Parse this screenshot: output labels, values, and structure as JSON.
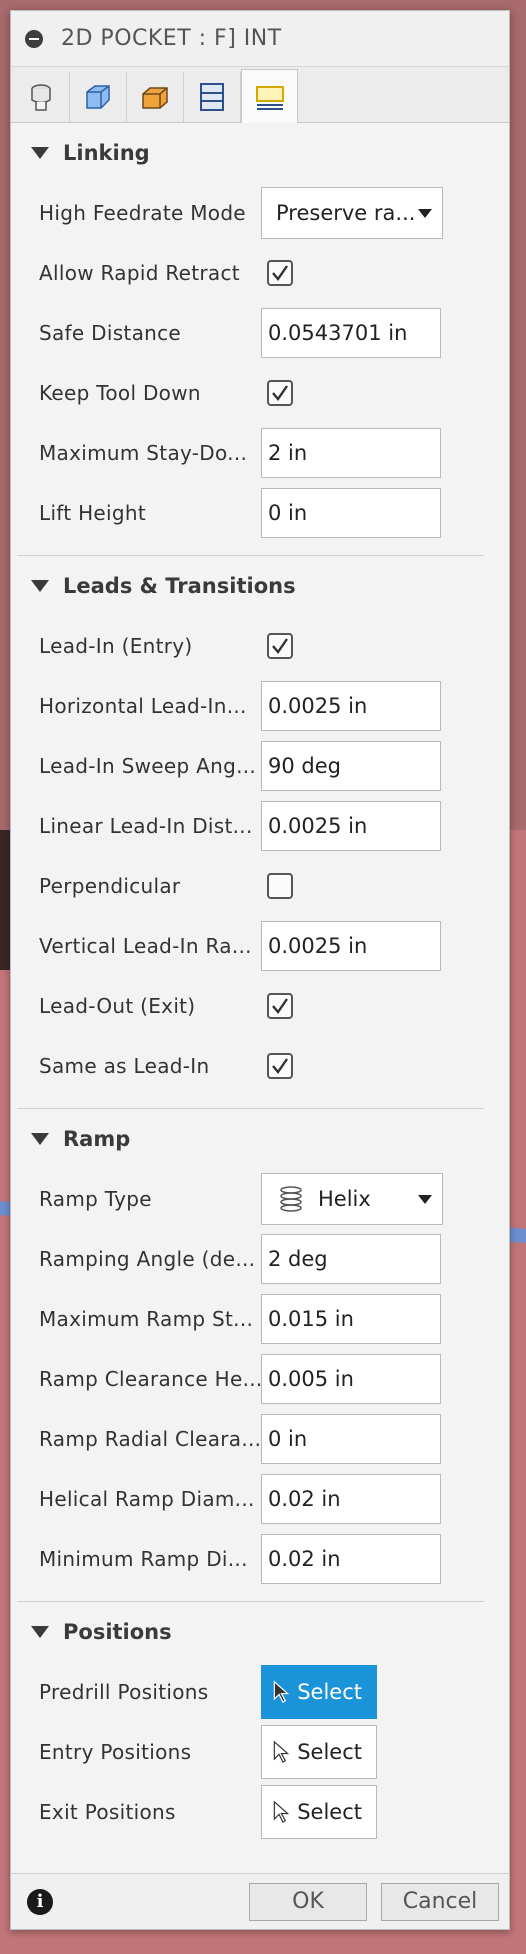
{
  "dialog": {
    "title": "2D POCKET : F] INT",
    "tabs": [
      {
        "icon": "tool-icon",
        "active": false
      },
      {
        "icon": "geometry-icon",
        "active": false
      },
      {
        "icon": "heights-icon",
        "active": false
      },
      {
        "icon": "passes-icon",
        "active": false
      },
      {
        "icon": "linking-icon",
        "active": true
      }
    ]
  },
  "linking": {
    "header": "Linking",
    "high_feedrate_mode_label": "High Feedrate Mode",
    "high_feedrate_mode_value": "Preserve ra...",
    "allow_rapid_retract_label": "Allow Rapid Retract",
    "safe_distance_label": "Safe Distance",
    "safe_distance_value": "0.0543701 in",
    "keep_tool_down_label": "Keep Tool Down",
    "max_stay_down_label": "Maximum Stay-Do...",
    "max_stay_down_value": "2 in",
    "lift_height_label": "Lift Height",
    "lift_height_value": "0 in"
  },
  "leads": {
    "header": "Leads & Transitions",
    "lead_in_label": "Lead-In (Entry)",
    "horizontal_lead_in_label": "Horizontal Lead-In...",
    "horizontal_lead_in_value": "0.0025 in",
    "sweep_angle_label": "Lead-In Sweep Ang...",
    "sweep_angle_value": "90 deg",
    "linear_lead_in_label": "Linear Lead-In Dist...",
    "linear_lead_in_value": "0.0025 in",
    "perpendicular_label": "Perpendicular",
    "vertical_lead_in_label": "Vertical Lead-In Ra...",
    "vertical_lead_in_value": "0.0025 in",
    "lead_out_label": "Lead-Out (Exit)",
    "same_as_lead_in_label": "Same as Lead-In"
  },
  "ramp": {
    "header": "Ramp",
    "ramp_type_label": "Ramp Type",
    "ramp_type_value": "Helix",
    "ramping_angle_label": "Ramping Angle (de...",
    "ramping_angle_value": "2 deg",
    "max_ramp_step_label": "Maximum Ramp St...",
    "max_ramp_step_value": "0.015 in",
    "ramp_clearance_label": "Ramp Clearance He...",
    "ramp_clearance_value": "0.005 in",
    "ramp_radial_label": "Ramp Radial Cleara...",
    "ramp_radial_value": "0 in",
    "helical_diam_label": "Helical Ramp Diam...",
    "helical_diam_value": "0.02 in",
    "min_ramp_diam_label": "Minimum Ramp Di...",
    "min_ramp_diam_value": "0.02 in"
  },
  "positions": {
    "header": "Positions",
    "predrill_label": "Predrill Positions",
    "entry_label": "Entry Positions",
    "exit_label": "Exit Positions",
    "select_label": "Select"
  },
  "checkboxes": {
    "allow_rapid_retract": true,
    "keep_tool_down": true,
    "lead_in": true,
    "perpendicular": false,
    "lead_out": true,
    "same_as_lead_in": true
  },
  "footer": {
    "ok_label": "OK",
    "cancel_label": "Cancel"
  },
  "colors": {
    "accent": "#1b93d8",
    "tab_highlight": "#f2c200"
  }
}
